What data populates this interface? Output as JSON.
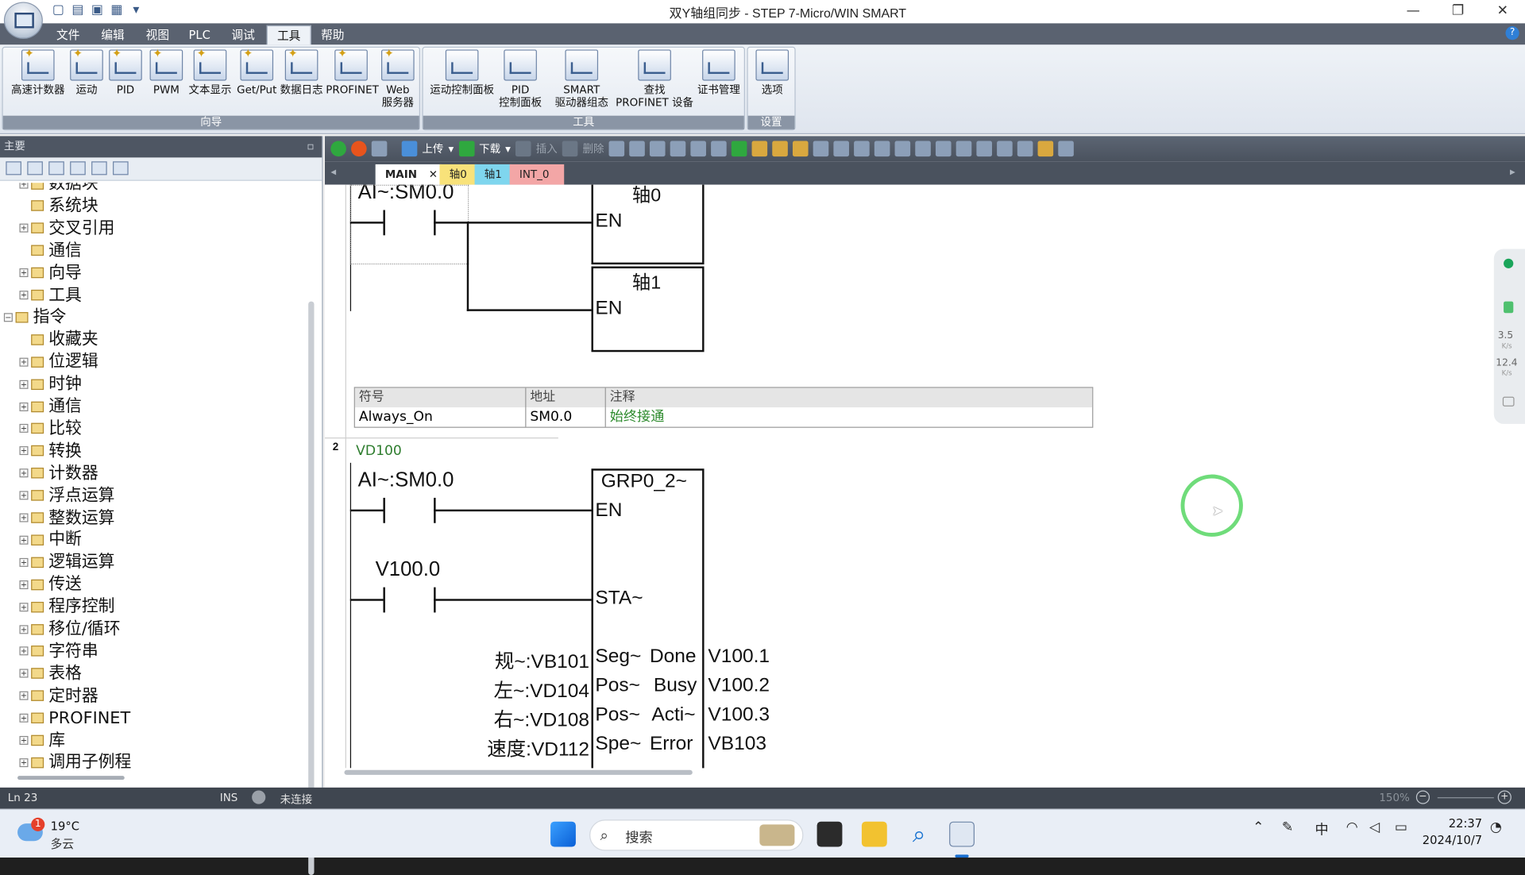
{
  "window": {
    "title": "双Y轴组同步 - STEP 7-Micro/WIN SMART",
    "minimize": "—",
    "restore": "❐",
    "close": "✕"
  },
  "menu": {
    "tabs": [
      "文件",
      "编辑",
      "视图",
      "PLC",
      "调试",
      "工具",
      "帮助"
    ],
    "active": "工具"
  },
  "ribbon": {
    "wizards": {
      "label": "向导",
      "buttons": [
        "高速计数器",
        "运动",
        "PID",
        "PWM",
        "文本显示",
        "Get/Put",
        "数据日志",
        "PROFINET",
        "Web\n服务器"
      ]
    },
    "tools": {
      "label": "工具",
      "buttons": [
        "运动控制面板",
        "PID\n控制面板",
        "SMART\n驱动器组态",
        "查找\nPROFINET 设备",
        "证书管理"
      ]
    },
    "settings": {
      "label": "设置",
      "buttons": [
        "选项"
      ]
    }
  },
  "left_panel": {
    "title": "主要",
    "tree": [
      {
        "label": "数据块",
        "expandable": true,
        "indent": 1
      },
      {
        "label": "系统块",
        "expandable": false,
        "indent": 1
      },
      {
        "label": "交叉引用",
        "expandable": true,
        "indent": 1
      },
      {
        "label": "通信",
        "expandable": false,
        "indent": 1
      },
      {
        "label": "向导",
        "expandable": true,
        "indent": 1
      },
      {
        "label": "工具",
        "expandable": true,
        "indent": 1
      },
      {
        "label": "指令",
        "expandable": true,
        "indent": 0
      },
      {
        "label": "收藏夹",
        "expandable": false,
        "indent": 1
      },
      {
        "label": "位逻辑",
        "expandable": true,
        "indent": 1
      },
      {
        "label": "时钟",
        "expandable": true,
        "indent": 1
      },
      {
        "label": "通信",
        "expandable": true,
        "indent": 1
      },
      {
        "label": "比较",
        "expandable": true,
        "indent": 1
      },
      {
        "label": "转换",
        "expandable": true,
        "indent": 1
      },
      {
        "label": "计数器",
        "expandable": true,
        "indent": 1
      },
      {
        "label": "浮点运算",
        "expandable": true,
        "indent": 1
      },
      {
        "label": "整数运算",
        "expandable": true,
        "indent": 1
      },
      {
        "label": "中断",
        "expandable": true,
        "indent": 1
      },
      {
        "label": "逻辑运算",
        "expandable": true,
        "indent": 1
      },
      {
        "label": "传送",
        "expandable": true,
        "indent": 1
      },
      {
        "label": "程序控制",
        "expandable": true,
        "indent": 1
      },
      {
        "label": "移位/循环",
        "expandable": true,
        "indent": 1
      },
      {
        "label": "字符串",
        "expandable": true,
        "indent": 1
      },
      {
        "label": "表格",
        "expandable": true,
        "indent": 1
      },
      {
        "label": "定时器",
        "expandable": true,
        "indent": 1
      },
      {
        "label": "PROFINET",
        "expandable": true,
        "indent": 1
      },
      {
        "label": "库",
        "expandable": true,
        "indent": 1
      },
      {
        "label": "调用子例程",
        "expandable": true,
        "indent": 1
      }
    ]
  },
  "editor_toolbar": {
    "upload": "上传",
    "download": "下载",
    "insert": "插入",
    "delete": "删除"
  },
  "editor_tabs": [
    {
      "label": "MAIN",
      "color": "#ffffff"
    },
    {
      "label": "轴0",
      "color": "#f8e27a"
    },
    {
      "label": "轴1",
      "color": "#7fd6ee"
    },
    {
      "label": "INT_0",
      "color": "#f3a6a6"
    }
  ],
  "network1": {
    "contact": "AI~:SM0.0",
    "box1_title": "轴0",
    "box1_en": "EN",
    "box2_title": "轴1",
    "box2_en": "EN",
    "symbol_table": {
      "headers": [
        "符号",
        "地址",
        "注释"
      ],
      "rows": [
        [
          "Always_On",
          "SM0.0",
          "始终接通"
        ]
      ]
    }
  },
  "network2": {
    "number": "2",
    "comment": "VD100",
    "contact1": "AI~:SM0.0",
    "contact2": "V100.0",
    "box_title": "GRP0_2~",
    "en": "EN",
    "sta": "STA~",
    "inputs": [
      {
        "label": "规~:VB101",
        "pin": "Seg~"
      },
      {
        "label": "左~:VD104",
        "pin": "Pos~"
      },
      {
        "label": "右~:VD108",
        "pin": "Pos~"
      },
      {
        "label": "速度:VD112",
        "pin": "Spe~"
      }
    ],
    "outputs": [
      {
        "pin": "Done",
        "label": "V100.1"
      },
      {
        "pin": "Busy",
        "label": "V100.2"
      },
      {
        "pin": "Acti~",
        "label": "V100.3"
      },
      {
        "pin": "Error",
        "label": "VB103"
      }
    ]
  },
  "side_widget": {
    "up_speed": "3.5",
    "up_unit": "K/s",
    "down_speed": "12.4",
    "down_unit": "K/s"
  },
  "status": {
    "line": "Ln 23",
    "mode": "INS",
    "connection": "未连接",
    "zoom": "150%"
  },
  "taskbar": {
    "temperature": "19°C",
    "weather": "多云",
    "badge": "1",
    "search_placeholder": "搜索",
    "ime": "中",
    "time": "22:37",
    "date": "2024/10/7"
  }
}
